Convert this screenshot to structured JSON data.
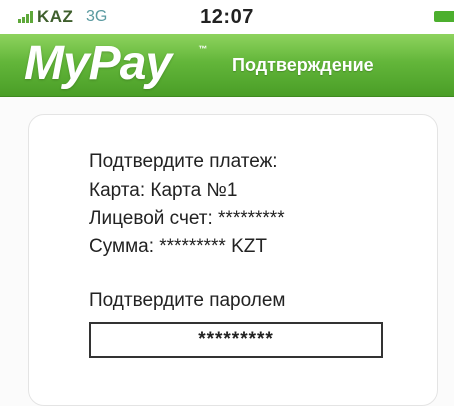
{
  "status_bar": {
    "carrier": "KAZ",
    "network": "3G",
    "time": "12:07"
  },
  "header": {
    "logo": "MyPay",
    "logo_tm": "™",
    "title": "Подтверждение"
  },
  "confirmation": {
    "heading": "Подтвердите платеж:",
    "card_line": "Карта: Карта №1",
    "account_line": "Лицевой счет: *********",
    "amount_line": "Сумма: ********* KZT",
    "password_prompt": "Подтвердите паролем",
    "password_value": "*********"
  },
  "colors": {
    "header_green": "#63b63a",
    "status_green": "#4caf2e"
  }
}
